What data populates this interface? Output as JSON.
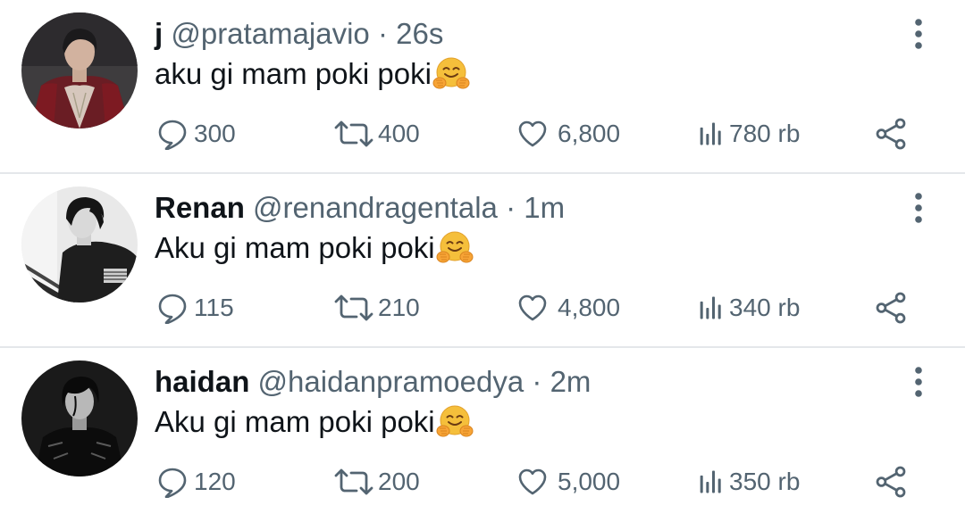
{
  "tweets": [
    {
      "name": "j",
      "handle": "@pratamajavio",
      "separator": "·",
      "time": "26s",
      "text": "aku gi mam poki poki",
      "emoji": "hugging-face-emoji",
      "stats": {
        "replies": "300",
        "retweets": "400",
        "likes": "6,800",
        "views": "780 rb"
      }
    },
    {
      "name": "Renan",
      "handle": "@renandragentala",
      "separator": "·",
      "time": "1m",
      "text": "Aku gi mam poki poki",
      "emoji": "hugging-face-emoji",
      "stats": {
        "replies": "115",
        "retweets": "210",
        "likes": "4,800",
        "views": "340 rb"
      }
    },
    {
      "name": "haidan",
      "handle": "@haidanpramoedya",
      "separator": "·",
      "time": "2m",
      "text": "Aku gi mam poki poki",
      "emoji": "hugging-face-emoji",
      "stats": {
        "replies": "120",
        "retweets": "200",
        "likes": "5,000",
        "views": "350 rb"
      }
    }
  ],
  "colors": {
    "text_primary": "#0f1419",
    "text_secondary": "#536471",
    "divider": "#e4e7ea",
    "background": "#ffffff"
  },
  "icons": [
    "reply-icon",
    "retweet-icon",
    "like-icon",
    "views-icon",
    "share-icon",
    "more-options-icon"
  ]
}
